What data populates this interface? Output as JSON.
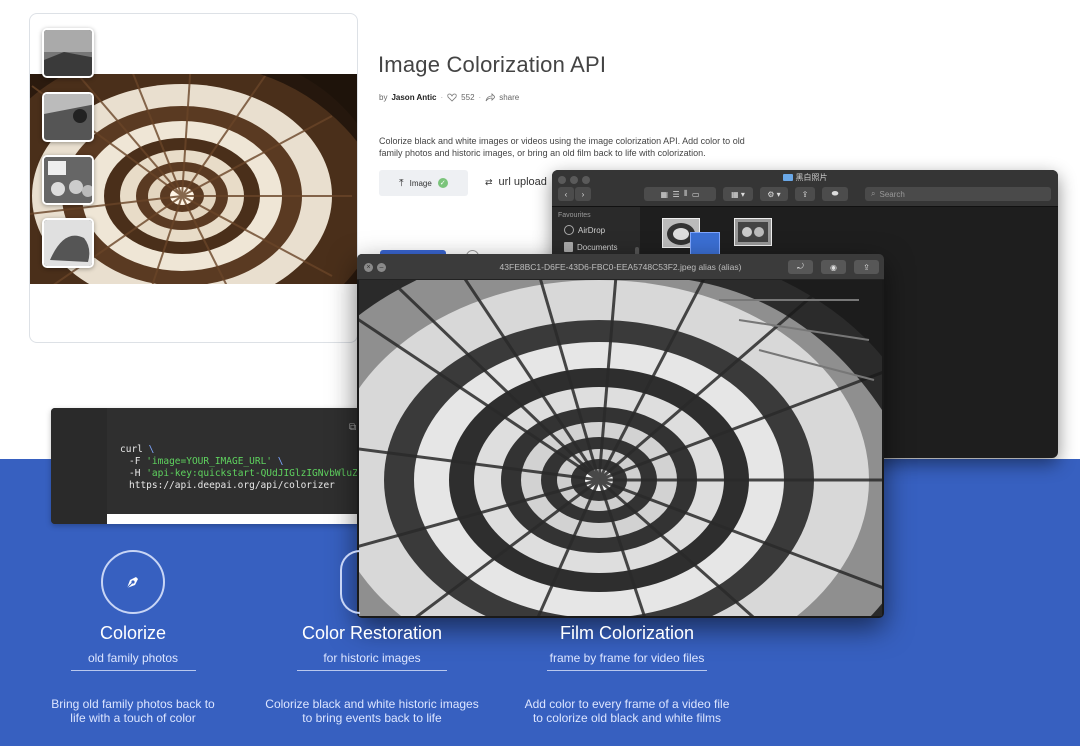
{
  "page": {
    "title": "Image Colorization API",
    "author_prefix": "by",
    "author": "Jason Antic",
    "likes": "552",
    "share_label": "share",
    "description": "Colorize black and white images or videos using the image colorization API. Add color to old family photos and historic images, or bring an old film back to life with colorization.",
    "image_button": "Image",
    "url_upload": "url upload"
  },
  "code": {
    "line1_cmd": "curl",
    "line1_bs": "\\",
    "line2_flag": "-F",
    "line2_str": "'image=YOUR_IMAGE_URL'",
    "line2_bs": "\\",
    "line3_flag": "-H",
    "line3_str": "'api-key:quickstart-QUdJIGlzIGNvbWluZy4uLi",
    "line4": "https://api.deepai.org/api/colorizer",
    "copy_icon": "copy-icon"
  },
  "finder": {
    "window_title": "黑白照片",
    "search_placeholder": "Search",
    "sidebar_header": "Favourites",
    "sidebar_items": [
      "AirDrop",
      "Documents"
    ]
  },
  "preview": {
    "window_title": "43FE8BC1-D6FE-43D6-FBC0-EEA5748C53F2.jpeg alias (alias)"
  },
  "features": [
    {
      "title": "Colorize",
      "subtitle": "old family photos",
      "description": "Bring old family photos back to life with a touch of color",
      "icon": "pen-icon"
    },
    {
      "title": "Color Restoration",
      "subtitle": "for historic images",
      "description": "Colorize black and white historic images to bring events back to life",
      "icon": "image-icon"
    },
    {
      "title": "Film Colorization",
      "subtitle": "frame by frame for video files",
      "description": "Add color to every frame of a video file to colorize old black and white films",
      "icon": "film-icon"
    }
  ],
  "colors": {
    "band_blue": "#3760c0",
    "submit_blue": "#3a66d2",
    "code_string": "#5fd35f",
    "stair_sepia": "#6b4a2e"
  }
}
